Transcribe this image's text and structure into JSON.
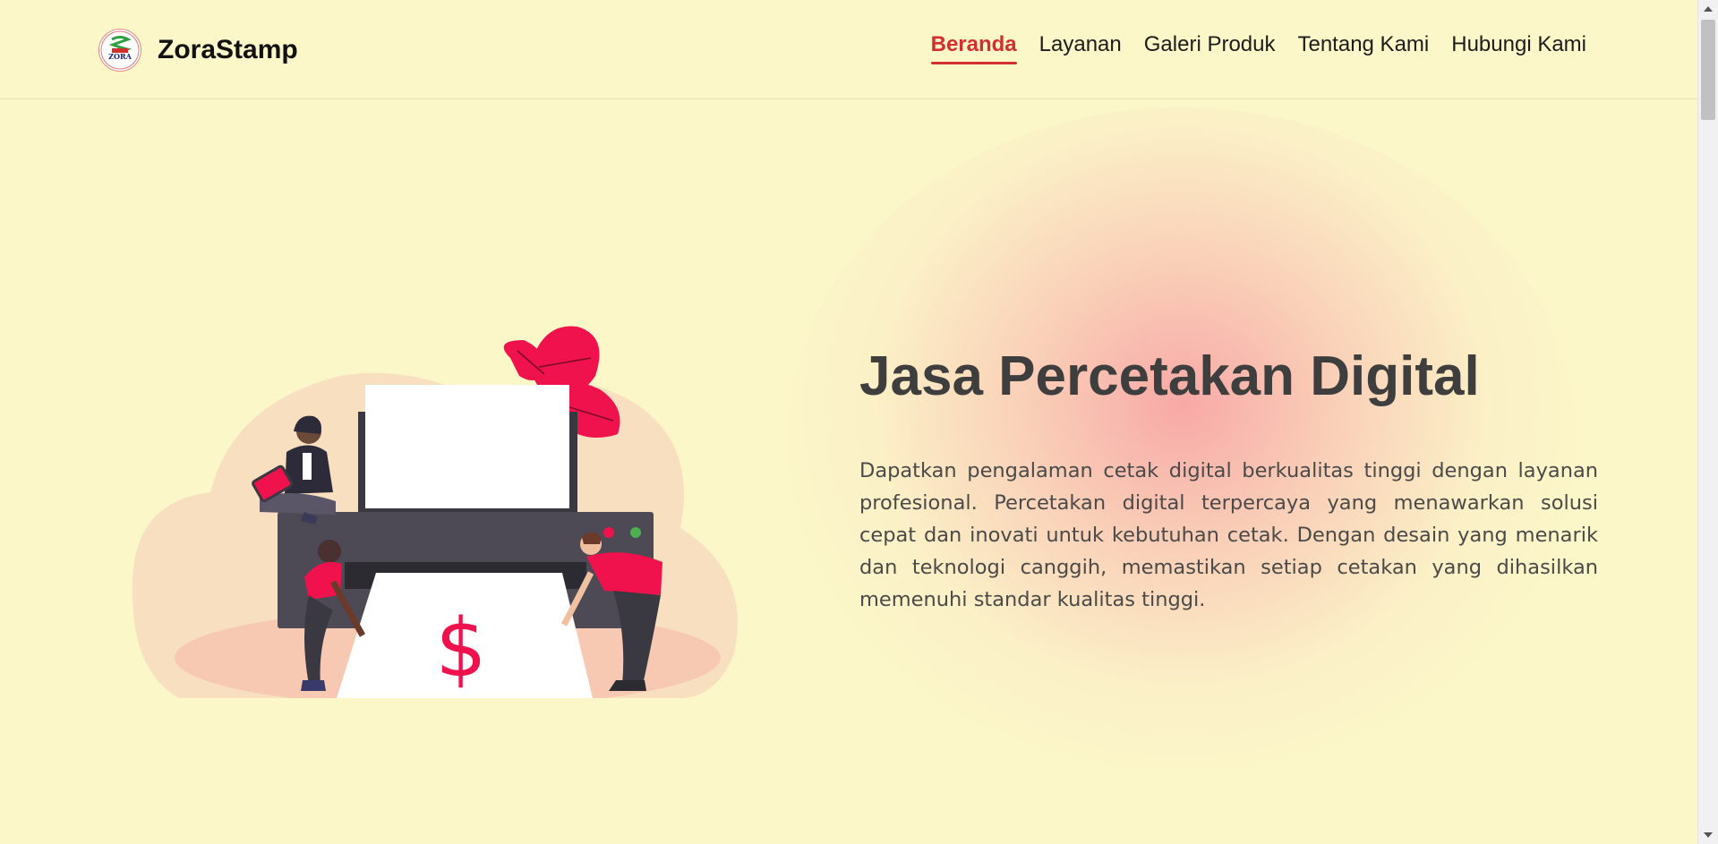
{
  "brand": {
    "name": "ZoraStamp",
    "logo_text": "ZORA"
  },
  "nav": {
    "items": [
      {
        "label": "Beranda",
        "active": true
      },
      {
        "label": "Layanan",
        "active": false
      },
      {
        "label": "Galeri Produk",
        "active": false
      },
      {
        "label": "Tentang Kami",
        "active": false
      },
      {
        "label": "Hubungi Kami",
        "active": false
      }
    ]
  },
  "hero": {
    "title": "Jasa Percetakan Digital",
    "description": "Dapatkan pengalaman cetak digital berkualitas tinggi dengan layanan profesional. Percetakan digital terpercaya yang menawarkan solusi cepat dan inovati untuk kebutuhan cetak. Dengan desain yang menarik dan teknologi canggih, memastikan setiap cetakan yang dihasilkan memenuhi standar kualitas tinggi.",
    "illustration_symbol": "$"
  },
  "colors": {
    "background": "#fbf7c9",
    "accent": "#d32f2f",
    "illustration_red": "#f0124d",
    "printer_dark": "#4d4a55"
  }
}
